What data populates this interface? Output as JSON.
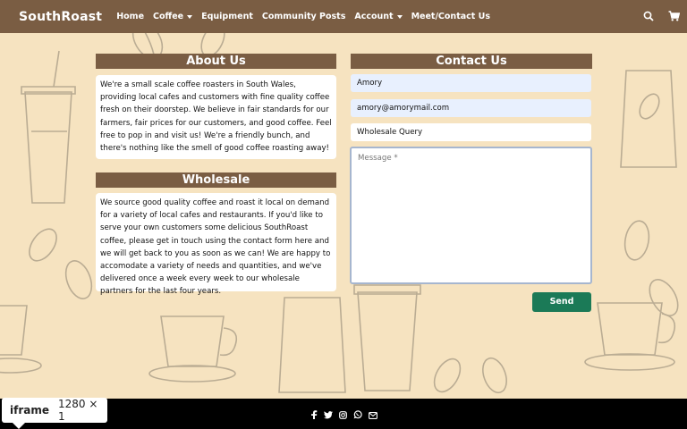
{
  "navbar": {
    "brand": "SouthRoast",
    "links": [
      {
        "label": "Home",
        "dropdown": false
      },
      {
        "label": "Coffee",
        "dropdown": true
      },
      {
        "label": "Equipment",
        "dropdown": false
      },
      {
        "label": "Community Posts",
        "dropdown": false
      },
      {
        "label": "Account",
        "dropdown": true
      },
      {
        "label": "Meet/Contact Us",
        "dropdown": false
      }
    ],
    "icons": [
      "search-icon",
      "cart-icon"
    ]
  },
  "about": {
    "title": "About Us",
    "text": "We're a small scale coffee roasters in South Wales, providing local cafes and customers with fine quality coffee fresh on their doorstep. We believe in fair standards for our farmers, fair prices for our customers, and good coffee. Feel free to pop in and visit us! We're a friendly bunch, and there's nothing like the smell of good coffee roasting away!"
  },
  "wholesale": {
    "title": "Wholesale",
    "text": "We source good quality coffee and roast it local on demand for a variety of local cafes and restaurants. If you'd like to serve your own customers some delicious SouthRoast coffee, please get in touch using the contact form here and we will get back to you as soon as we can! We are happy to accomodate a variety of needs and quantities, and we've delivered once a week every week to our wholesale partners for the last four years."
  },
  "contact": {
    "title": "Contact Us",
    "name_value": "Amory",
    "email_value": "amory@amorymail.com",
    "subject_value": "Wholesale Query",
    "message_placeholder": "Message *",
    "send_label": "Send"
  },
  "footer": {
    "icons": [
      "facebook-icon",
      "twitter-icon",
      "instagram-icon",
      "whatsapp-icon",
      "mail-icon"
    ]
  },
  "devtools_tag": {
    "label": "iframe",
    "size": "1280 × 1"
  },
  "colors": {
    "nav_bg": "#7a5d43",
    "page_bg": "#f6e3c0",
    "send_bg": "#1b7a57",
    "footer_bg": "#000000"
  }
}
